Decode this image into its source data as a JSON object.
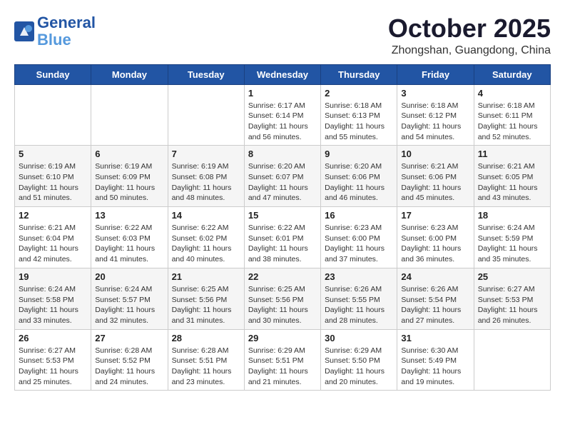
{
  "header": {
    "logo_line1": "General",
    "logo_line2": "Blue",
    "month": "October 2025",
    "location": "Zhongshan, Guangdong, China"
  },
  "weekdays": [
    "Sunday",
    "Monday",
    "Tuesday",
    "Wednesday",
    "Thursday",
    "Friday",
    "Saturday"
  ],
  "weeks": [
    [
      {
        "day": "",
        "info": ""
      },
      {
        "day": "",
        "info": ""
      },
      {
        "day": "",
        "info": ""
      },
      {
        "day": "1",
        "info": "Sunrise: 6:17 AM\nSunset: 6:14 PM\nDaylight: 11 hours\nand 56 minutes."
      },
      {
        "day": "2",
        "info": "Sunrise: 6:18 AM\nSunset: 6:13 PM\nDaylight: 11 hours\nand 55 minutes."
      },
      {
        "day": "3",
        "info": "Sunrise: 6:18 AM\nSunset: 6:12 PM\nDaylight: 11 hours\nand 54 minutes."
      },
      {
        "day": "4",
        "info": "Sunrise: 6:18 AM\nSunset: 6:11 PM\nDaylight: 11 hours\nand 52 minutes."
      }
    ],
    [
      {
        "day": "5",
        "info": "Sunrise: 6:19 AM\nSunset: 6:10 PM\nDaylight: 11 hours\nand 51 minutes."
      },
      {
        "day": "6",
        "info": "Sunrise: 6:19 AM\nSunset: 6:09 PM\nDaylight: 11 hours\nand 50 minutes."
      },
      {
        "day": "7",
        "info": "Sunrise: 6:19 AM\nSunset: 6:08 PM\nDaylight: 11 hours\nand 48 minutes."
      },
      {
        "day": "8",
        "info": "Sunrise: 6:20 AM\nSunset: 6:07 PM\nDaylight: 11 hours\nand 47 minutes."
      },
      {
        "day": "9",
        "info": "Sunrise: 6:20 AM\nSunset: 6:06 PM\nDaylight: 11 hours\nand 46 minutes."
      },
      {
        "day": "10",
        "info": "Sunrise: 6:21 AM\nSunset: 6:06 PM\nDaylight: 11 hours\nand 45 minutes."
      },
      {
        "day": "11",
        "info": "Sunrise: 6:21 AM\nSunset: 6:05 PM\nDaylight: 11 hours\nand 43 minutes."
      }
    ],
    [
      {
        "day": "12",
        "info": "Sunrise: 6:21 AM\nSunset: 6:04 PM\nDaylight: 11 hours\nand 42 minutes."
      },
      {
        "day": "13",
        "info": "Sunrise: 6:22 AM\nSunset: 6:03 PM\nDaylight: 11 hours\nand 41 minutes."
      },
      {
        "day": "14",
        "info": "Sunrise: 6:22 AM\nSunset: 6:02 PM\nDaylight: 11 hours\nand 40 minutes."
      },
      {
        "day": "15",
        "info": "Sunrise: 6:22 AM\nSunset: 6:01 PM\nDaylight: 11 hours\nand 38 minutes."
      },
      {
        "day": "16",
        "info": "Sunrise: 6:23 AM\nSunset: 6:00 PM\nDaylight: 11 hours\nand 37 minutes."
      },
      {
        "day": "17",
        "info": "Sunrise: 6:23 AM\nSunset: 6:00 PM\nDaylight: 11 hours\nand 36 minutes."
      },
      {
        "day": "18",
        "info": "Sunrise: 6:24 AM\nSunset: 5:59 PM\nDaylight: 11 hours\nand 35 minutes."
      }
    ],
    [
      {
        "day": "19",
        "info": "Sunrise: 6:24 AM\nSunset: 5:58 PM\nDaylight: 11 hours\nand 33 minutes."
      },
      {
        "day": "20",
        "info": "Sunrise: 6:24 AM\nSunset: 5:57 PM\nDaylight: 11 hours\nand 32 minutes."
      },
      {
        "day": "21",
        "info": "Sunrise: 6:25 AM\nSunset: 5:56 PM\nDaylight: 11 hours\nand 31 minutes."
      },
      {
        "day": "22",
        "info": "Sunrise: 6:25 AM\nSunset: 5:56 PM\nDaylight: 11 hours\nand 30 minutes."
      },
      {
        "day": "23",
        "info": "Sunrise: 6:26 AM\nSunset: 5:55 PM\nDaylight: 11 hours\nand 28 minutes."
      },
      {
        "day": "24",
        "info": "Sunrise: 6:26 AM\nSunset: 5:54 PM\nDaylight: 11 hours\nand 27 minutes."
      },
      {
        "day": "25",
        "info": "Sunrise: 6:27 AM\nSunset: 5:53 PM\nDaylight: 11 hours\nand 26 minutes."
      }
    ],
    [
      {
        "day": "26",
        "info": "Sunrise: 6:27 AM\nSunset: 5:53 PM\nDaylight: 11 hours\nand 25 minutes."
      },
      {
        "day": "27",
        "info": "Sunrise: 6:28 AM\nSunset: 5:52 PM\nDaylight: 11 hours\nand 24 minutes."
      },
      {
        "day": "28",
        "info": "Sunrise: 6:28 AM\nSunset: 5:51 PM\nDaylight: 11 hours\nand 23 minutes."
      },
      {
        "day": "29",
        "info": "Sunrise: 6:29 AM\nSunset: 5:51 PM\nDaylight: 11 hours\nand 21 minutes."
      },
      {
        "day": "30",
        "info": "Sunrise: 6:29 AM\nSunset: 5:50 PM\nDaylight: 11 hours\nand 20 minutes."
      },
      {
        "day": "31",
        "info": "Sunrise: 6:30 AM\nSunset: 5:49 PM\nDaylight: 11 hours\nand 19 minutes."
      },
      {
        "day": "",
        "info": ""
      }
    ]
  ]
}
